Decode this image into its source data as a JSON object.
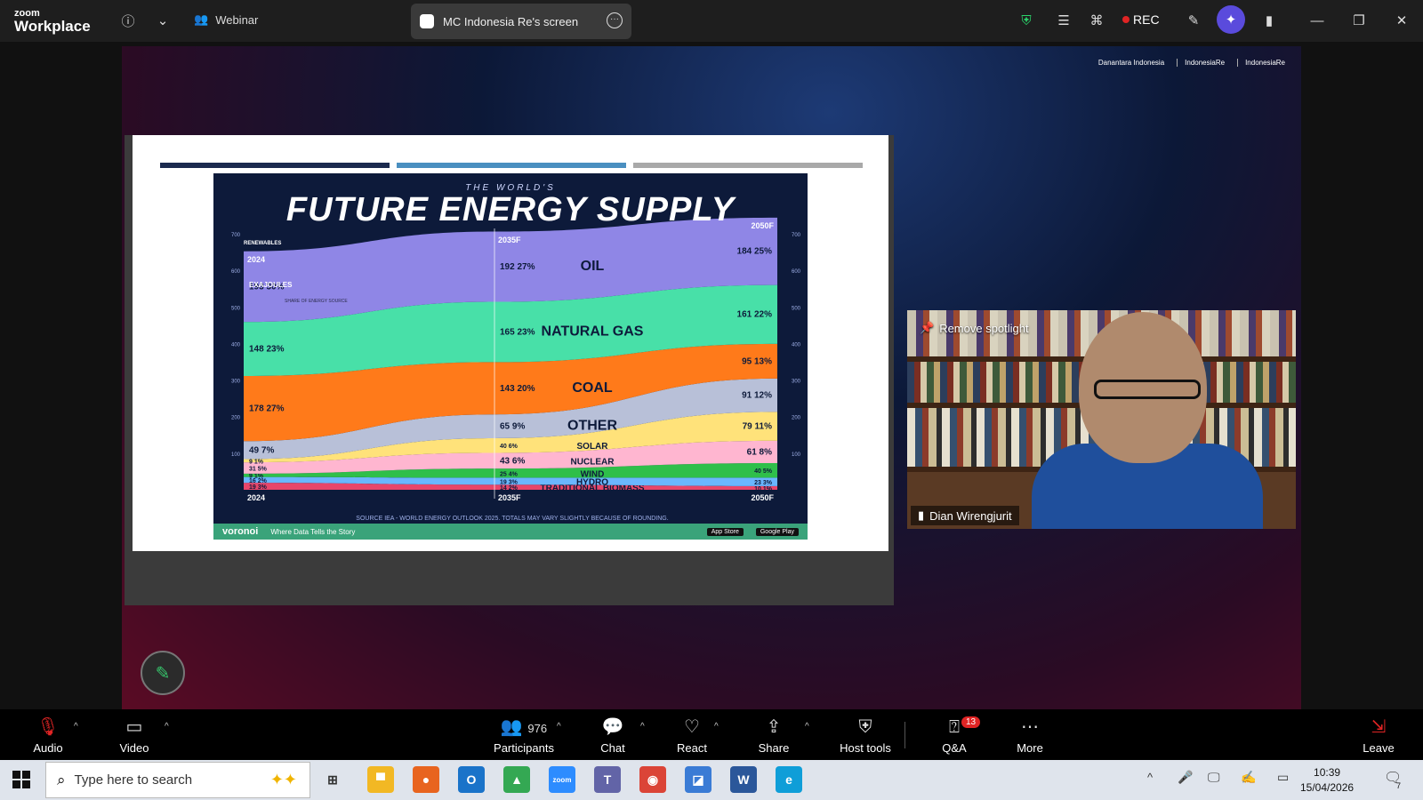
{
  "app": {
    "logo_top": "zoom",
    "logo_bottom": "Workplace",
    "mode": "Webinar",
    "share_label": "MC Indonesia Re's screen",
    "rec_label": "REC"
  },
  "slide": {
    "overlay_logos": [
      "Danantara Indonesia",
      "IndonesiaRe",
      "IndonesiaRe"
    ],
    "infographic": {
      "subtitle": "THE WORLD'S",
      "title": "FUTURE ENERGY SUPPLY",
      "footer_brand": "voronoi",
      "footer_tagline": "Where Data Tells the Story",
      "app_store": "App Store",
      "google_play": "Google Play",
      "source": "SOURCE IEA - WORLD ENERGY OUTLOOK 2025. TOTALS MAY VARY SLIGHTLY BECAUSE OF ROUNDING."
    }
  },
  "chart_data": {
    "type": "area",
    "title": "FUTURE ENERGY SUPPLY",
    "subtitle": "THE WORLD'S",
    "ylabel": "EXAJOULES",
    "x": [
      "2024",
      "2035F",
      "2050F"
    ],
    "series": [
      {
        "name": "OIL",
        "values": [
          193,
          192,
          184
        ],
        "shares": [
          "30%",
          "27%",
          "25%"
        ],
        "color": "#8f86e6"
      },
      {
        "name": "NATURAL GAS",
        "values": [
          148,
          165,
          161
        ],
        "shares": [
          "23%",
          "23%",
          "22%"
        ],
        "color": "#48e0a8"
      },
      {
        "name": "COAL",
        "values": [
          178,
          143,
          95
        ],
        "shares": [
          "27%",
          "20%",
          "13%"
        ],
        "color": "#ff7a1a"
      },
      {
        "name": "OTHER",
        "values": [
          49,
          65,
          91
        ],
        "shares": [
          "7%",
          "9%",
          "12%"
        ],
        "color": "#b8c0d8"
      },
      {
        "name": "SOLAR",
        "values": [
          9,
          40,
          79
        ],
        "shares": [
          "1%",
          "6%",
          "11%"
        ],
        "color": "#ffe27a"
      },
      {
        "name": "NUCLEAR",
        "values": [
          31,
          43,
          61
        ],
        "shares": [
          "5%",
          "6%",
          "8%"
        ],
        "color": "#ffb6d0"
      },
      {
        "name": "WIND",
        "values": [
          9,
          25,
          40
        ],
        "shares": [
          "1%",
          "4%",
          "5%"
        ],
        "color": "#2fbf4a"
      },
      {
        "name": "HYDRO",
        "values": [
          16,
          19,
          23
        ],
        "shares": [
          "2%",
          "3%",
          "3%"
        ],
        "color": "#6ab7ff"
      },
      {
        "name": "TRADITIONAL BIOMASS",
        "values": [
          19,
          14,
          10
        ],
        "shares": [
          "3%",
          "2%",
          "1%"
        ],
        "color": "#e8466a"
      }
    ],
    "ylim": [
      0,
      700
    ],
    "y_ticks": [
      "100",
      "200",
      "300",
      "400",
      "500",
      "600",
      "700"
    ],
    "annotations": [
      "RENEWABLES",
      "SHARE OF ENERGY SOURCE"
    ]
  },
  "participant": {
    "name": "Dian Wirengjurit",
    "spotlight_label": "Remove spotlight"
  },
  "toolbar": {
    "audio": "Audio",
    "video": "Video",
    "participants": "Participants",
    "participants_count": "976",
    "chat": "Chat",
    "react": "React",
    "share": "Share",
    "host_tools": "Host tools",
    "qa": "Q&A",
    "qa_badge": "13",
    "more": "More",
    "leave": "Leave"
  },
  "taskbar": {
    "search_placeholder": "Type here to search",
    "time": "10:39",
    "date": "15/04/2026",
    "notif": "7",
    "apps": [
      {
        "name": "File Explorer",
        "color": "#f2b824",
        "glyph": "▀"
      },
      {
        "name": "Firefox",
        "color": "#e8641f",
        "glyph": "●"
      },
      {
        "name": "Outlook",
        "color": "#1a73c9",
        "glyph": "O"
      },
      {
        "name": "Google Drive",
        "color": "#34a853",
        "glyph": "▲"
      },
      {
        "name": "Zoom",
        "color": "#2d8cff",
        "glyph": "zoom"
      },
      {
        "name": "Teams",
        "color": "#6264a7",
        "glyph": "T"
      },
      {
        "name": "Chrome",
        "color": "#db4437",
        "glyph": "◉"
      },
      {
        "name": "Photos",
        "color": "#3a7bd5",
        "glyph": "◪"
      },
      {
        "name": "Word",
        "color": "#2b579a",
        "glyph": "W"
      },
      {
        "name": "Edge",
        "color": "#0f9ed8",
        "glyph": "e"
      }
    ]
  }
}
